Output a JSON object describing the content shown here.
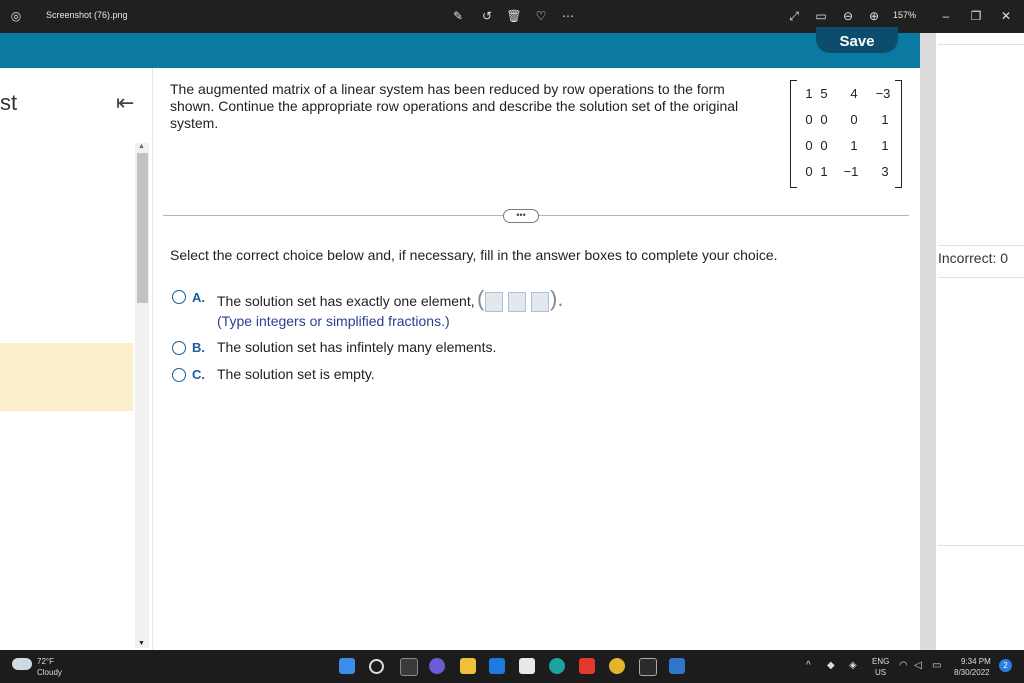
{
  "viewer": {
    "title": "Screenshot (76).png",
    "zoom": "157%"
  },
  "header": {
    "save_label": "Save"
  },
  "left_panel": {
    "partial_text": "st"
  },
  "question": {
    "prompt": "The augmented matrix of a linear system has been reduced by row operations to the form shown. Continue the appropriate row operations and describe the solution set of the original system.",
    "matrix": [
      [
        "1",
        "5",
        "4",
        "−3"
      ],
      [
        "0",
        "0",
        "0",
        "1"
      ],
      [
        "0",
        "0",
        "1",
        "1"
      ],
      [
        "0",
        "1",
        "−1",
        "3"
      ]
    ],
    "more_label": "•••",
    "instruction": "Select the correct choice below and, if necessary, fill in the answer boxes to complete your choice.",
    "options": [
      {
        "letter": "A.",
        "text": "The solution set has exactly one element,",
        "hint": "(Type integers or simplified fractions.)"
      },
      {
        "letter": "B.",
        "text": "The solution set has infintely many elements."
      },
      {
        "letter": "C.",
        "text": "The solution set is empty."
      }
    ]
  },
  "right_panel": {
    "incorrect": "Incorrect: 0"
  },
  "taskbar": {
    "temp": "72°F",
    "weather": "Cloudy",
    "lang": "ENG",
    "region": "US",
    "time": "9:34 PM",
    "date": "8/30/2022",
    "badge": "2"
  }
}
